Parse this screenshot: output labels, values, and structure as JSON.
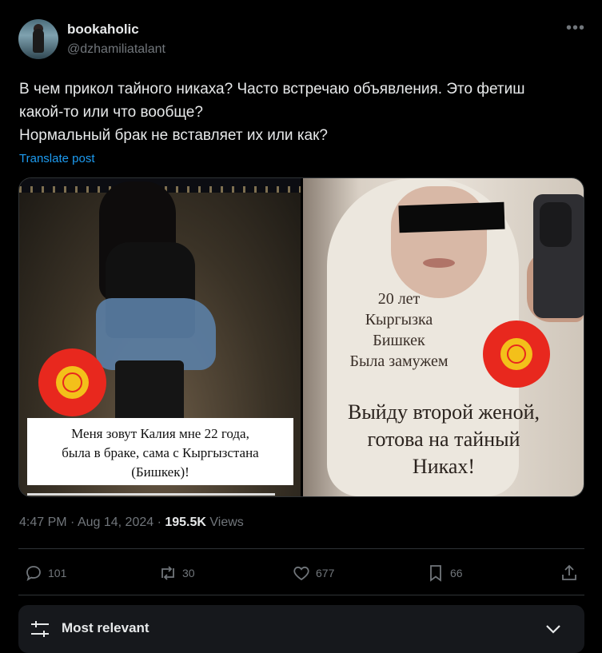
{
  "author": {
    "display_name": "bookaholic",
    "handle": "@dzhamiliatalant"
  },
  "more_icon": "more-horizontal-icon",
  "tweet": {
    "lines": [
      "В чем прикол тайного никаха? Часто встречаю объявления. Это фетиш",
      "какой-то или что вообще?",
      "Нормальный брак не вставляет их или как?"
    ],
    "translate_label": "Translate post"
  },
  "media": {
    "left_caption": [
      "Меня зовут Калия мне 22 года,",
      "была в браке,  сама с Кыргызстана",
      "(Бишкек)!"
    ],
    "right_overlay_small": [
      "20 лет",
      "Кыргызка",
      "Бишкек",
      "Была замужем"
    ],
    "right_overlay_big": [
      "Выйду второй женой,",
      "готова на тайный",
      "Никах!"
    ]
  },
  "meta": {
    "time": "4:47 PM",
    "sep": " · ",
    "date": "Aug 14, 2024",
    "sep2": " · ",
    "views_count": "195.5K",
    "views_label": " Views"
  },
  "actions": {
    "replies": "101",
    "reposts": "30",
    "likes": "677",
    "bookmarks": "66"
  },
  "sort": {
    "label": "Most relevant"
  },
  "colors": {
    "accent": "#1d9bf0",
    "muted": "#71767b",
    "text": "#e7e9ea",
    "background": "#000000"
  }
}
